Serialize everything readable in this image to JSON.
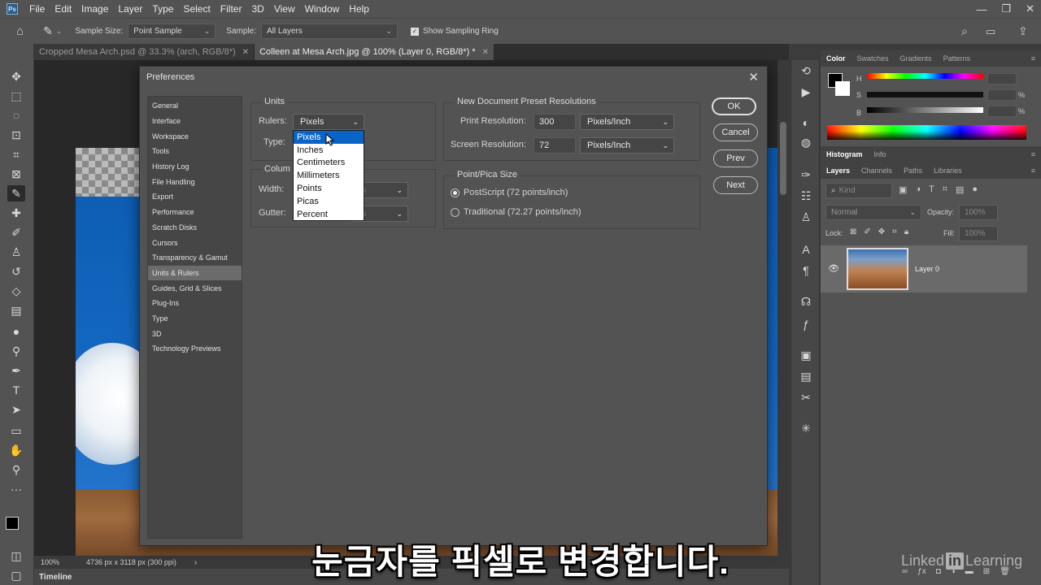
{
  "menubar": {
    "items": [
      "File",
      "Edit",
      "Image",
      "Layer",
      "Type",
      "Select",
      "Filter",
      "3D",
      "View",
      "Window",
      "Help"
    ]
  },
  "options_bar": {
    "sample_size_label": "Sample Size:",
    "sample_size_value": "Point Sample",
    "sample_label": "Sample:",
    "sample_value": "All Layers",
    "show_ring_label": "Show Sampling Ring"
  },
  "tabs": [
    {
      "label": "Cropped Mesa Arch.psd @ 33.3% (arch, RGB/8*)"
    },
    {
      "label": "Colleen at Mesa Arch.jpg @ 100% (Layer 0, RGB/8*) *"
    }
  ],
  "status": {
    "zoom": "100%",
    "doc_info": "4736 px x 3118 px (300 ppi)"
  },
  "timeline_label": "Timeline",
  "right_panels": {
    "color_tabs": [
      "Color",
      "Swatches",
      "Gradients",
      "Patterns"
    ],
    "hsb_labels": [
      "H",
      "S",
      "B"
    ],
    "hsb_units": [
      "",
      "%",
      "%"
    ],
    "hist_tabs": [
      "Histogram",
      "Info"
    ],
    "layer_tabs": [
      "Layers",
      "Channels",
      "Paths",
      "Libraries"
    ],
    "kind_placeholder": "Kind",
    "blend_mode": "Normal",
    "opacity_label": "Opacity:",
    "opacity_value": "100%",
    "lock_label": "Lock:",
    "fill_label": "Fill:",
    "fill_value": "100%",
    "layer_name": "Layer 0"
  },
  "dialog": {
    "title": "Preferences",
    "nav": [
      "General",
      "Interface",
      "Workspace",
      "Tools",
      "History Log",
      "File Handling",
      "Export",
      "Performance",
      "Scratch Disks",
      "Cursors",
      "Transparency & Gamut",
      "Units & Rulers",
      "Guides, Grid & Slices",
      "Plug-Ins",
      "Type",
      "3D",
      "Technology Previews"
    ],
    "units_group": "Units",
    "rulers_label": "Rulers:",
    "rulers_value": "Pixels",
    "type_label": "Type:",
    "column_group": "Colum",
    "width_label": "Width:",
    "width_unit_partial": "rs",
    "gutter_label": "Gutter:",
    "gutter_unit_partial": "rs",
    "preset_group": "New Document Preset Resolutions",
    "print_res_label": "Print Resolution:",
    "print_res_value": "300",
    "print_res_unit": "Pixels/Inch",
    "screen_res_label": "Screen Resolution:",
    "screen_res_value": "72",
    "screen_res_unit": "Pixels/Inch",
    "pica_group": "Point/Pica Size",
    "postscript_label": "PostScript (72 points/inch)",
    "traditional_label": "Traditional (72.27 points/inch)",
    "buttons": {
      "ok": "OK",
      "cancel": "Cancel",
      "prev": "Prev",
      "next": "Next"
    },
    "dropdown_options": [
      "Pixels",
      "Inches",
      "Centimeters",
      "Millimeters",
      "Points",
      "Picas",
      "Percent"
    ]
  },
  "subtitle": "눈금자를 픽셀로 변경합니다.",
  "watermark": {
    "pre": "Linked",
    "mid": "in",
    "post": "Learning"
  }
}
